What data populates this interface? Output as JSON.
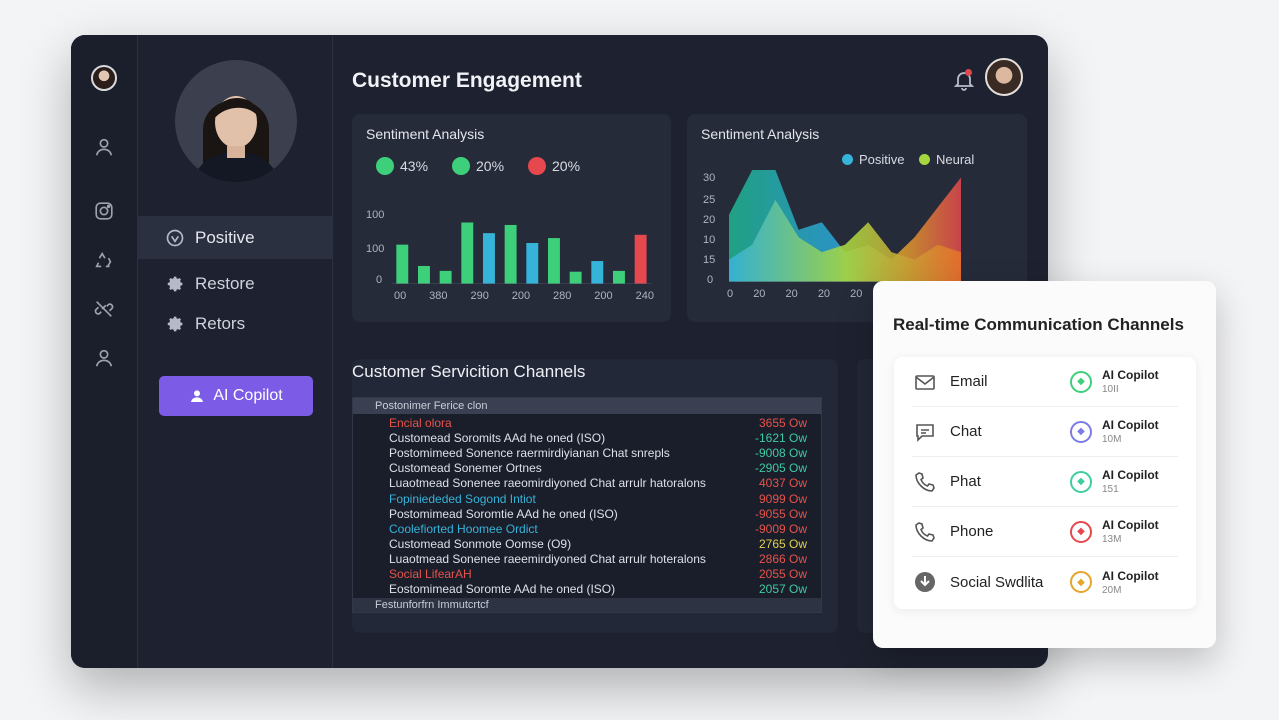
{
  "rail": {
    "icons": [
      "user-icon",
      "instagram-icon",
      "recycle-icon",
      "no-link-icon",
      "person-icon"
    ]
  },
  "sidebar": {
    "items": [
      {
        "label": "Positive",
        "icon": "shield-icon",
        "active": true
      },
      {
        "label": "Restore",
        "icon": "gear-icon",
        "active": false
      },
      {
        "label": "Retors",
        "icon": "gear-icon",
        "active": false
      }
    ],
    "copilot_label": "AI Copilot"
  },
  "header": {
    "title": "Customer Engagement"
  },
  "sentiment_left": {
    "title": "Sentiment Analysis",
    "stats": [
      {
        "value": "43%",
        "color": "#3ecf7b"
      },
      {
        "value": "20%",
        "color": "#3ecf7b"
      },
      {
        "value": "20%",
        "color": "#e5484d"
      }
    ],
    "yticks": [
      "100",
      "100",
      "0"
    ],
    "xticks": [
      "00",
      "380",
      "290",
      "200",
      "280",
      "200",
      "240"
    ]
  },
  "sentiment_right": {
    "title": "Sentiment Analysis",
    "legend": [
      {
        "label": "Positive",
        "color": "#36b3d9"
      },
      {
        "label": "Neural",
        "color": "#a5d640"
      }
    ],
    "yticks": [
      "30",
      "25",
      "20",
      "10",
      "15",
      "0"
    ],
    "xticks": [
      "0",
      "20",
      "20",
      "20",
      "20",
      "20",
      "20"
    ]
  },
  "chart_data": [
    {
      "type": "bar",
      "title": "Sentiment Analysis",
      "series": [
        {
          "values": [
            48,
            22,
            16,
            75,
            62,
            72,
            50,
            56,
            15,
            28,
            16,
            60
          ]
        }
      ],
      "ylim": [
        0,
        100
      ]
    },
    {
      "type": "area",
      "title": "Sentiment Analysis",
      "series": [
        {
          "name": "Positive",
          "values": [
            18,
            30,
            30,
            14,
            16,
            8,
            10,
            6,
            12,
            20,
            28
          ]
        },
        {
          "name": "Neural",
          "values": [
            6,
            10,
            22,
            12,
            8,
            10,
            16,
            8,
            6,
            10,
            8
          ]
        }
      ],
      "ylim": [
        0,
        30
      ]
    }
  ],
  "channels": {
    "title": "Customer Servicition Channels",
    "header": "Postonimer Ferice clon",
    "footer": "Festunforfrn Immutcrtcf",
    "rows": [
      {
        "label": "Encial olora",
        "value": "3655 Ow",
        "label_color": "#e5534b",
        "value_color": "red"
      },
      {
        "label": "Customead Soromits AAd he oned (ISO)",
        "value": "-1621 Ow",
        "label_color": "#dde0e8",
        "value_color": "green"
      },
      {
        "label": "Postomimeed Sonence raermirdiyianan Chat snrepls",
        "value": "-9008 Ow",
        "label_color": "#dde0e8",
        "value_color": "green"
      },
      {
        "label": "Customead Sonemer Ortnes",
        "value": "-2905 Ow",
        "label_color": "#dde0e8",
        "value_color": "green"
      },
      {
        "label": "Luaotmead Sonenee raeomirdiyoned Chat arrulr hatoralons",
        "value": "4037 Ow",
        "label_color": "#dde0e8",
        "value_color": "red"
      },
      {
        "label": "Fopiniededed Sogond Intiot",
        "value": "9099 Ow",
        "label_color": "#36b3d9",
        "value_color": "red"
      },
      {
        "label": "Postomimead Soromtie AAd he oned (ISO)",
        "value": "-9055 Ow",
        "label_color": "#dde0e8",
        "value_color": "red"
      },
      {
        "label": "Coolefiorted Hoomee Ordict",
        "value": "-9009 Ow",
        "label_color": "#36b3d9",
        "value_color": "red"
      },
      {
        "label": "Customead Sonmote Oomse (O9)",
        "value": "2765 Ow",
        "label_color": "#dde0e8",
        "value_color": "yellow"
      },
      {
        "label": "Luaotmead Sonenee raeemirdiyoned Chat arrulr hoteralons",
        "value": "2866 Ow",
        "label_color": "#dde0e8",
        "value_color": "red"
      },
      {
        "label": "Social LifearAH",
        "value": "2055 Ow",
        "label_color": "#e5534b",
        "value_color": "red"
      },
      {
        "label": "Eostomimead Soromte AAd he oned (ISO)",
        "value": "2057 Ow",
        "label_color": "#dde0e8",
        "value_color": "green"
      }
    ]
  },
  "realtime": {
    "title": "Real-time Communication Channels",
    "items": [
      {
        "name": "Email",
        "icon": "mail-icon",
        "badge_color": "#3ecf7b",
        "copilot": "AI Copilot",
        "count": "10II"
      },
      {
        "name": "Chat",
        "icon": "chat-icon",
        "badge_color": "#7c7ce6",
        "copilot": "AI Copilot",
        "count": "10M"
      },
      {
        "name": "Phat",
        "icon": "phone-icon",
        "badge_color": "#3ecfa0",
        "copilot": "AI Copilot",
        "count": "151"
      },
      {
        "name": "Phone",
        "icon": "phone-icon",
        "badge_color": "#e5484d",
        "copilot": "AI Copilot",
        "count": "13M"
      },
      {
        "name": "Social Swdlita",
        "icon": "download-icon",
        "badge_color": "#e5a52b",
        "copilot": "AI Copilot",
        "count": "20M"
      }
    ]
  }
}
